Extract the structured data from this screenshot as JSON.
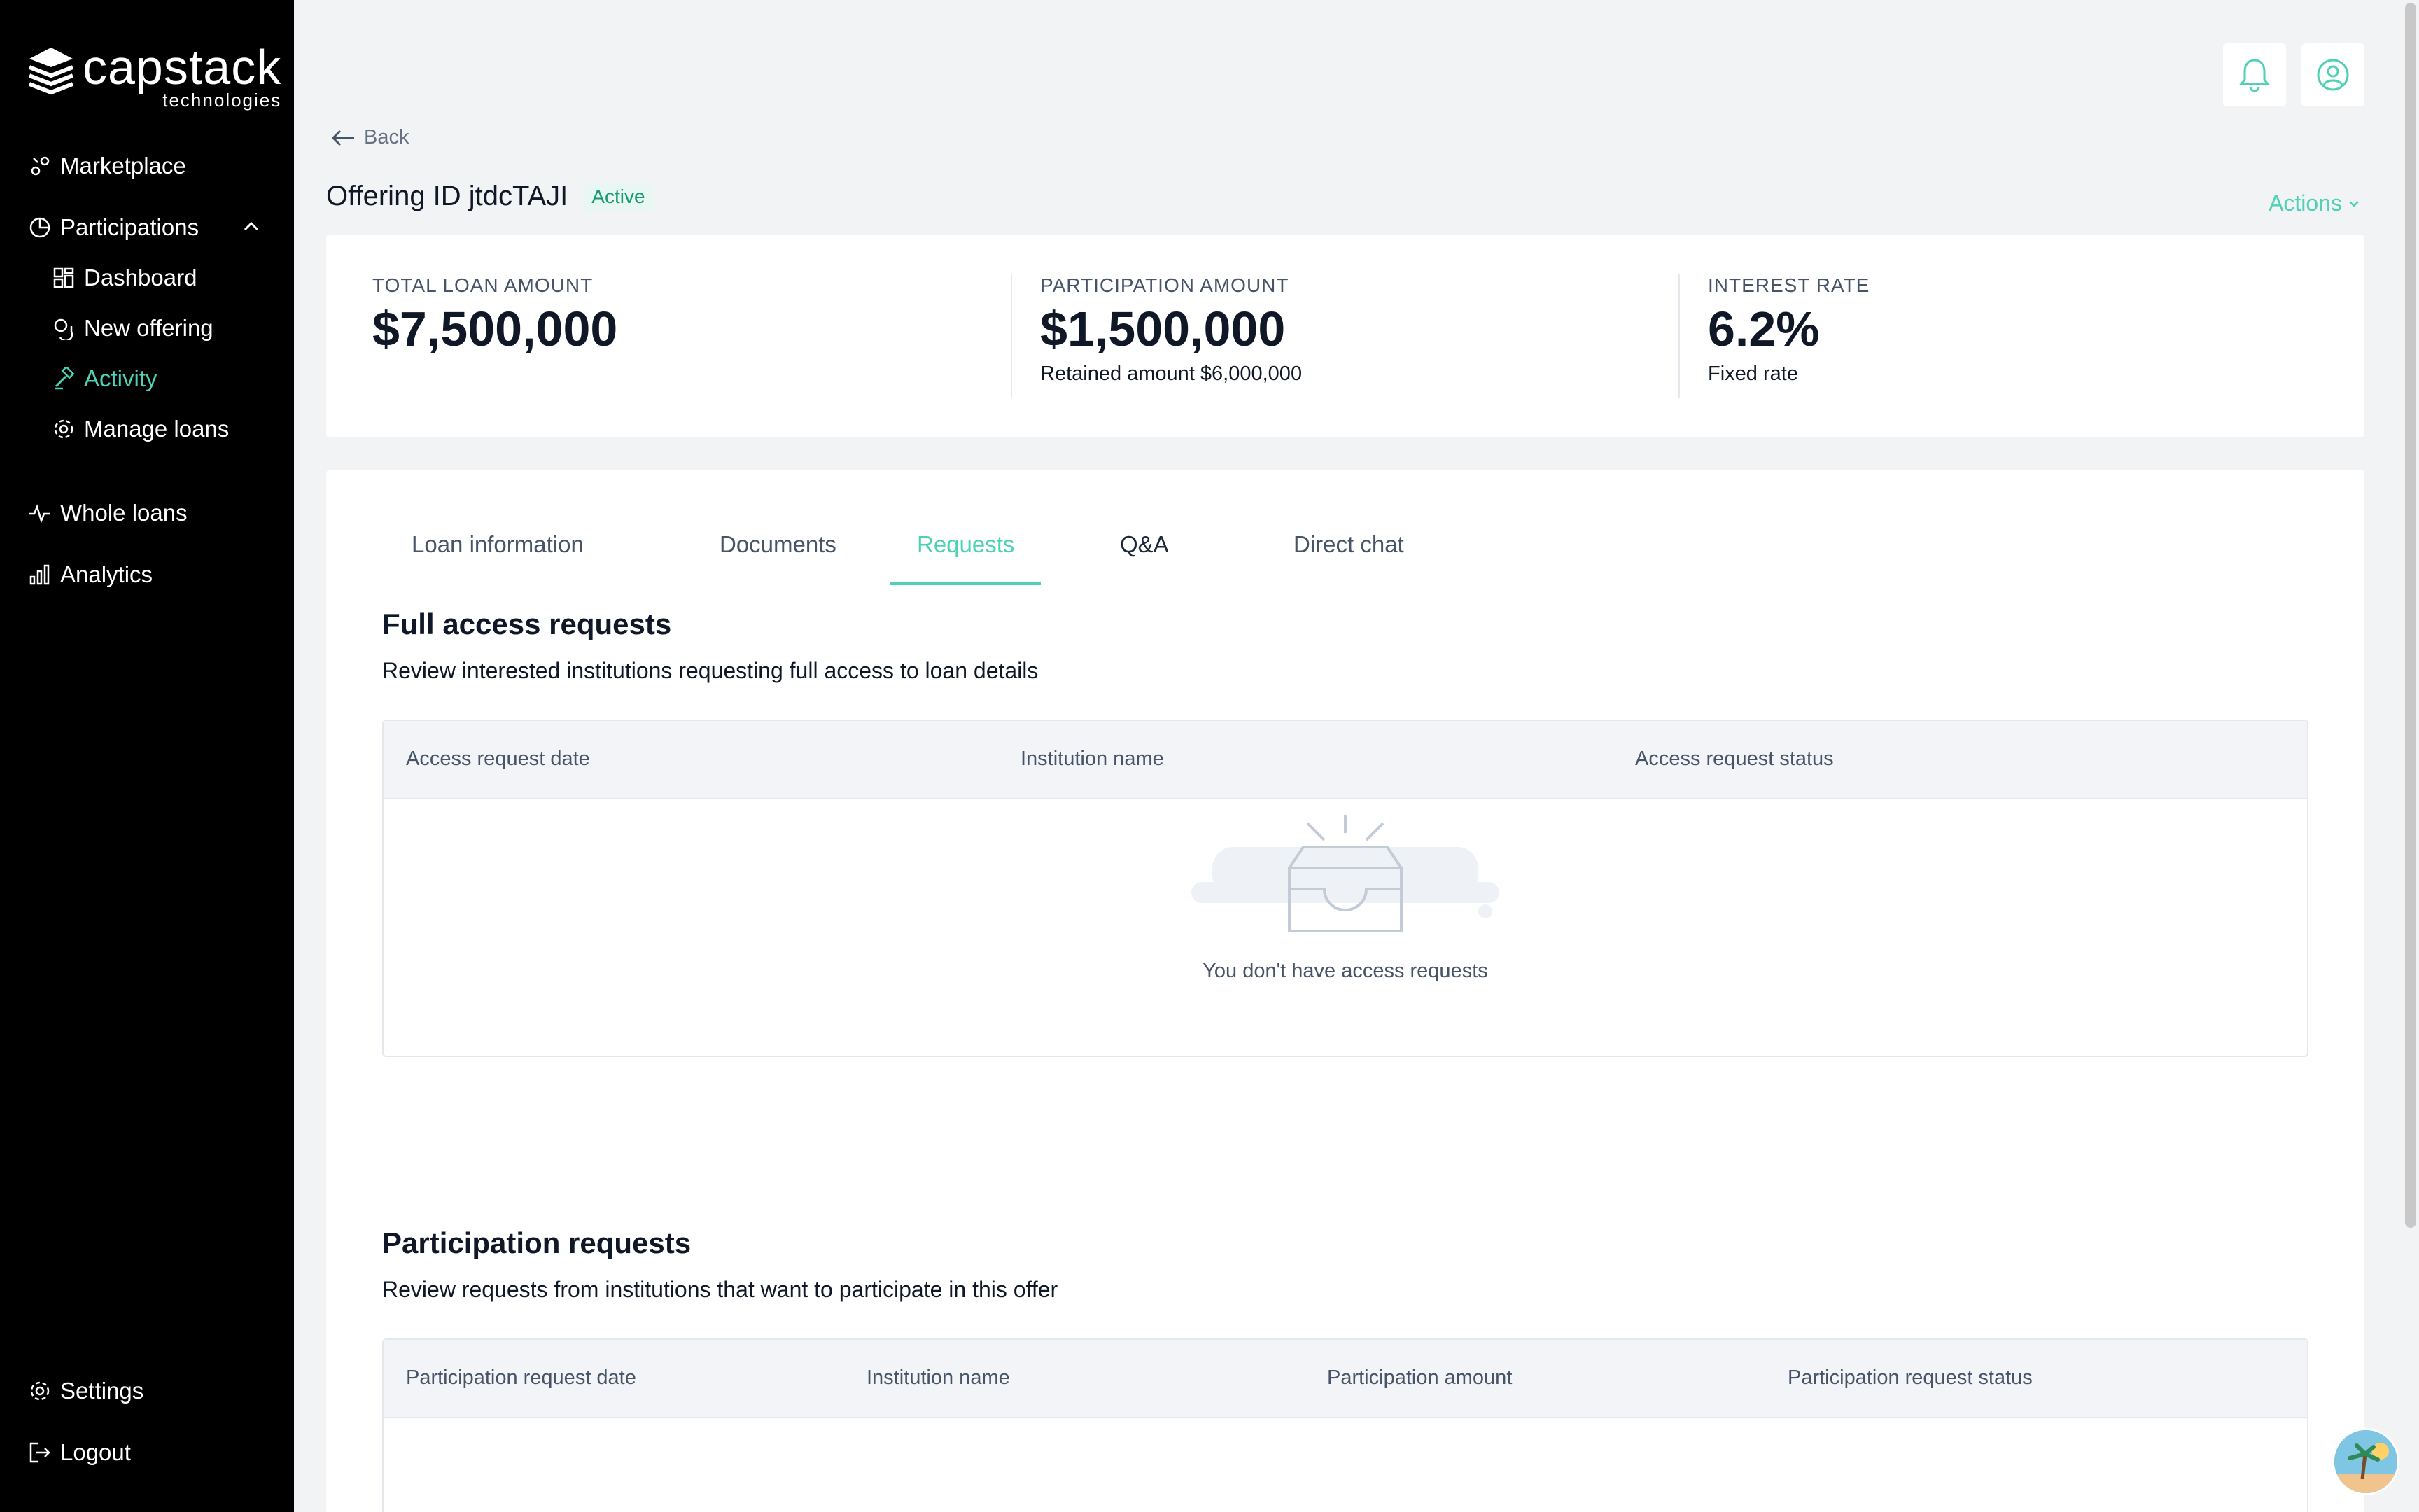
{
  "brand": {
    "name": "capstack",
    "sub": "technologies"
  },
  "sidebar": {
    "items": [
      {
        "label": "Marketplace"
      },
      {
        "label": "Participations"
      },
      {
        "label": "Dashboard"
      },
      {
        "label": "New offering"
      },
      {
        "label": "Activity"
      },
      {
        "label": "Manage loans"
      },
      {
        "label": "Whole loans"
      },
      {
        "label": "Analytics"
      }
    ],
    "bottom": [
      {
        "label": "Settings"
      },
      {
        "label": "Logout"
      }
    ]
  },
  "header": {
    "back_label": "Back",
    "title": "Offering ID jtdcTAJI",
    "status": "Active",
    "actions_label": "Actions"
  },
  "stats": [
    {
      "label": "TOTAL LOAN AMOUNT",
      "value": "$7,500,000",
      "sub": ""
    },
    {
      "label": "PARTICIPATION AMOUNT",
      "value": "$1,500,000",
      "sub": "Retained amount $6,000,000"
    },
    {
      "label": "INTEREST RATE",
      "value": "6.2%",
      "sub": "Fixed rate"
    }
  ],
  "tabs": [
    {
      "label": "Loan information"
    },
    {
      "label": "Documents"
    },
    {
      "label": "Requests"
    },
    {
      "label": "Q&A"
    },
    {
      "label": "Direct chat"
    }
  ],
  "access_requests": {
    "title": "Full access requests",
    "subtitle": "Review interested institutions requesting full access to loan details",
    "columns": [
      "Access request date",
      "Institution name",
      "Access request status"
    ],
    "empty_text": "You don't have access requests"
  },
  "participation_requests": {
    "title": "Participation requests",
    "subtitle": "Review requests from institutions that want to participate in this offer",
    "columns": [
      "Participation request date",
      "Institution name",
      "Participation amount",
      "Participation request status"
    ]
  },
  "colors": {
    "accent": "#4fd1b5",
    "sidebar_bg": "#000000",
    "badge_bg": "#e8f7f1",
    "badge_text": "#179a6e"
  }
}
